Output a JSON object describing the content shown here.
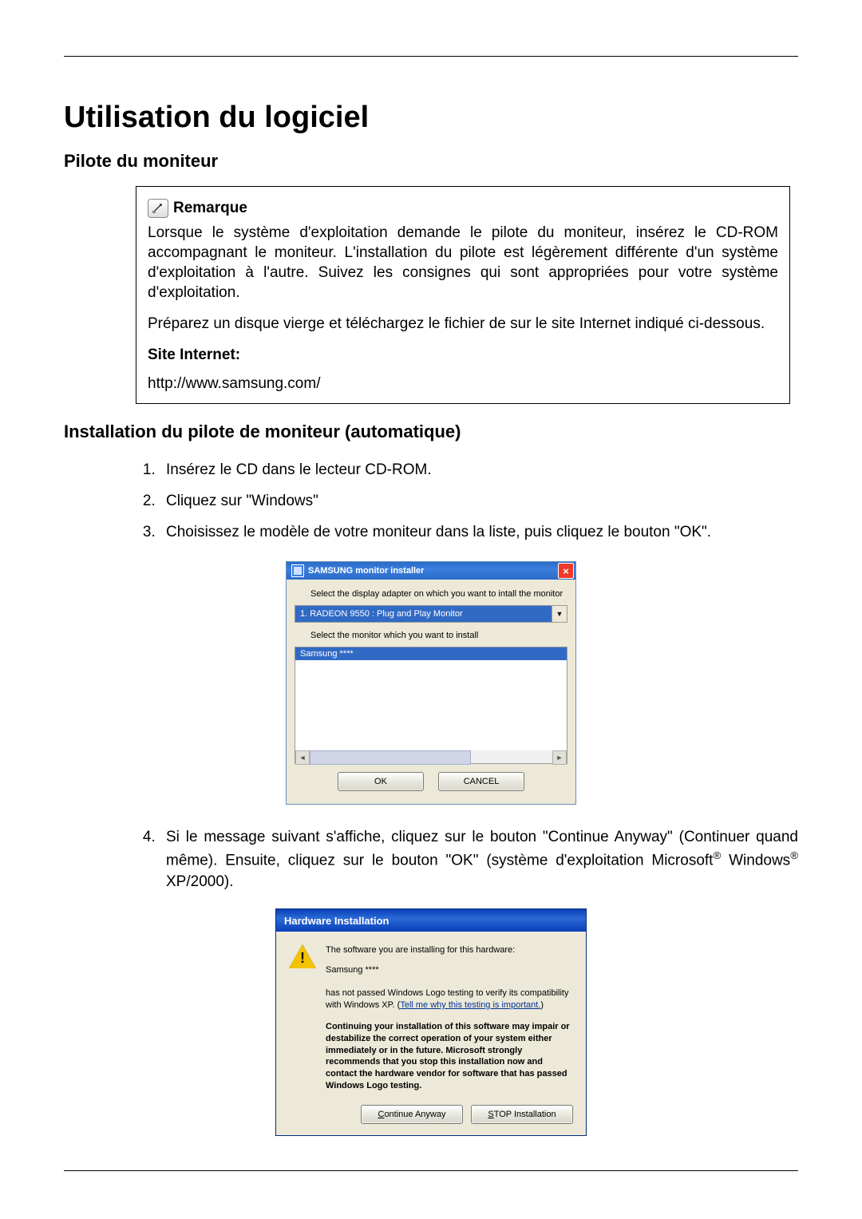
{
  "page": {
    "title": "Utilisation du logiciel",
    "section1": "Pilote du moniteur",
    "note_label": "Remarque",
    "note_p1": "Lorsque le système d'exploitation demande le pilote du moniteur, insérez le CD-ROM accompagnant le moniteur. L'installation du pilote est légèrement différente d'un système d'exploitation à l'autre. Suivez les consignes qui sont appropriées pour votre système d'exploitation.",
    "note_p2": "Préparez un disque vierge et téléchargez le fichier de sur le site Internet indiqué ci-dessous.",
    "site_label": "Site Internet:",
    "site_url": "http://www.samsung.com/",
    "section2": "Installation du pilote de moniteur (automatique)",
    "steps": {
      "s1": "Insérez le CD dans le lecteur CD-ROM.",
      "s2": "Cliquez sur \"Windows\"",
      "s3": "Choisissez le modèle de votre moniteur dans la liste, puis cliquez le bouton \"OK\".",
      "s4_a": "Si le message suivant s'affiche, cliquez sur le bouton \"Continue Anyway\" (Continuer quand même). Ensuite, cliquez sur le bouton \"OK\" (système d'exploitation Microsoft",
      "s4_b": " Windows",
      "s4_c": " XP/2000)."
    }
  },
  "dlg1": {
    "title": "SAMSUNG monitor installer",
    "label1": "Select the display adapter on which you want to intall the monitor",
    "combo": "1. RADEON 9550 : Plug and Play Monitor",
    "label2": "Select the monitor which you want to install",
    "selected": "Samsung ****",
    "ok": "OK",
    "cancel": "CANCEL"
  },
  "dlg2": {
    "title": "Hardware Installation",
    "line1": "The software you are installing for this hardware:",
    "hwname": "Samsung ****",
    "logo_a": "has not passed Windows Logo testing to verify its compatibility with Windows XP. (",
    "logo_link": "Tell me why this testing is important.",
    "logo_b": ")",
    "warn": "Continuing your installation of this software may impair or destabilize the correct operation of your system either immediately or in the future. Microsoft strongly recommends that you stop this installation now and contact the hardware vendor for software that has passed Windows Logo testing.",
    "btn_continue_u": "C",
    "btn_continue_rest": "ontinue Anyway",
    "btn_stop_u": "S",
    "btn_stop_rest": "TOP Installation"
  }
}
